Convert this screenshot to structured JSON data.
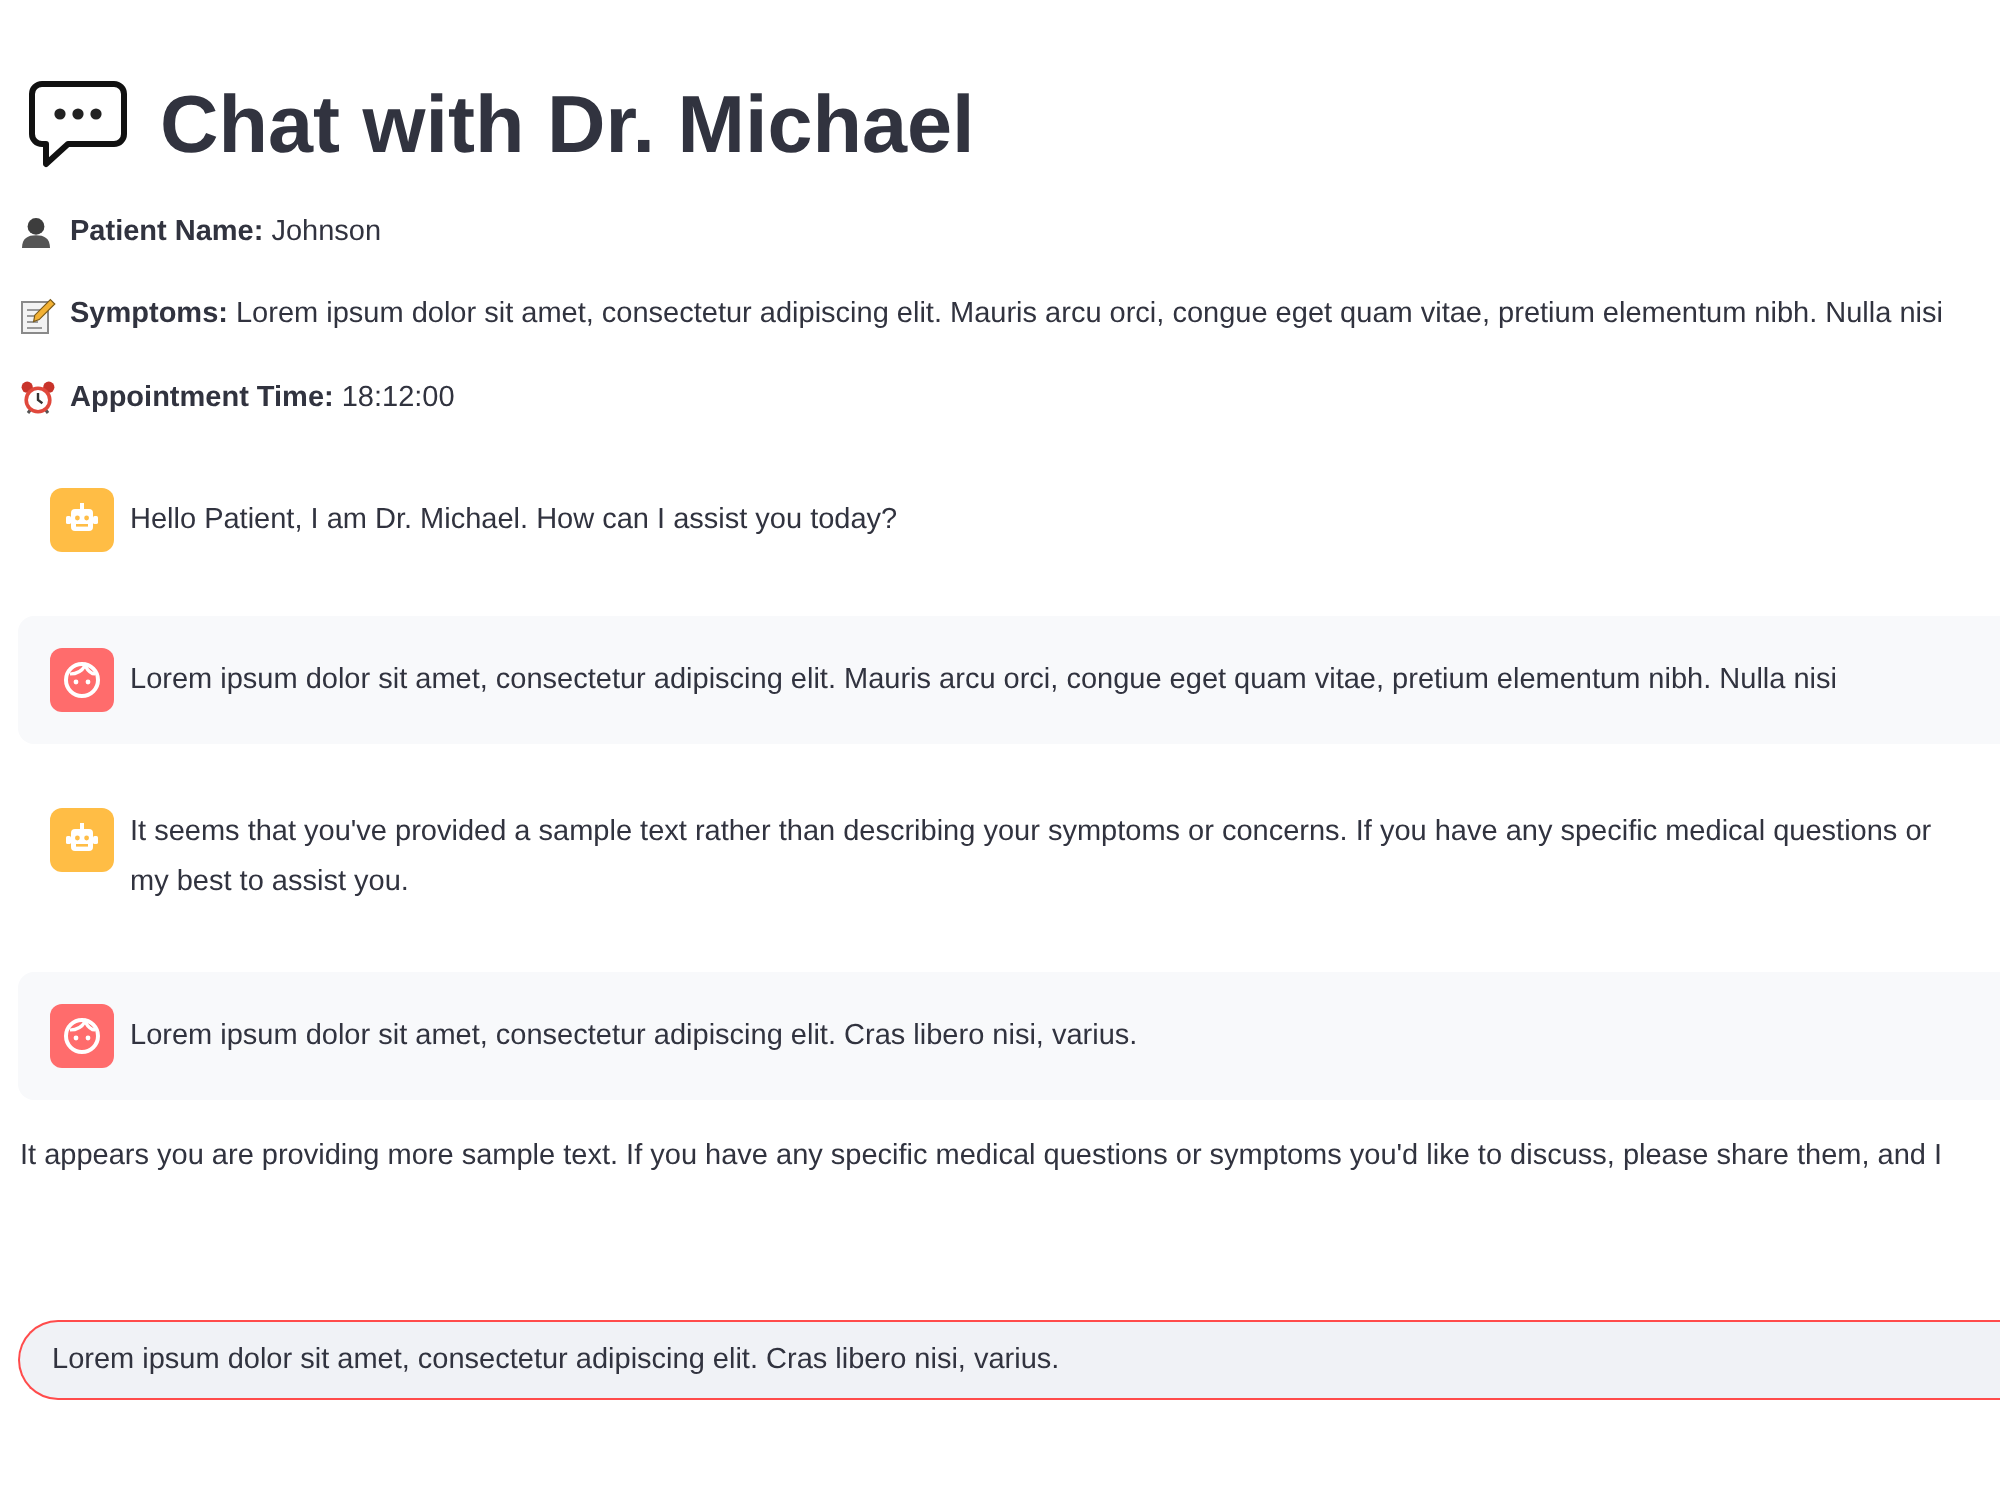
{
  "header": {
    "title": "Chat with Dr. Michael"
  },
  "details": [
    {
      "kind": "patient",
      "text": "**Patient Name:** Johnson"
    },
    {
      "kind": "symptoms",
      "text": "**Symptoms:** Lorem ipsum dolor sit amet, consectetur adipiscing elit. Mauris arcu orci, congue eget quam vitae, pretium elementum nibh. Nulla nisi"
    },
    {
      "kind": "time",
      "text": "**Appointment Time:** 18:12:00"
    }
  ],
  "messages": [
    {
      "kind": "assistant",
      "lines": [
        "Hello Patient, I am Dr. Michael. How can I assist you today?"
      ]
    },
    {
      "kind": "user",
      "lines": [
        "Lorem ipsum dolor sit amet, consectetur adipiscing elit. Mauris arcu orci, congue eget quam vitae, pretium elementum nibh. Nulla nisi"
      ]
    },
    {
      "kind": "assistant",
      "lines": [
        "It seems that you've provided a sample text rather than describing your symptoms or concerns. If you have any specific medical questions or",
        "my best to assist you."
      ]
    },
    {
      "kind": "user",
      "lines": [
        "Lorem ipsum dolor sit amet, consectetur adipiscing elit. Cras libero nisi, varius."
      ]
    }
  ],
  "reply": {
    "text": "It appears you are providing more sample text. If you have any specific medical questions or symptoms you'd like to discuss, please share them, and I"
  },
  "input": {
    "value": "Lorem ipsum dolor sit amet, consectetur adipiscing elit. Cras libero nisi, varius.",
    "focused": true
  }
}
